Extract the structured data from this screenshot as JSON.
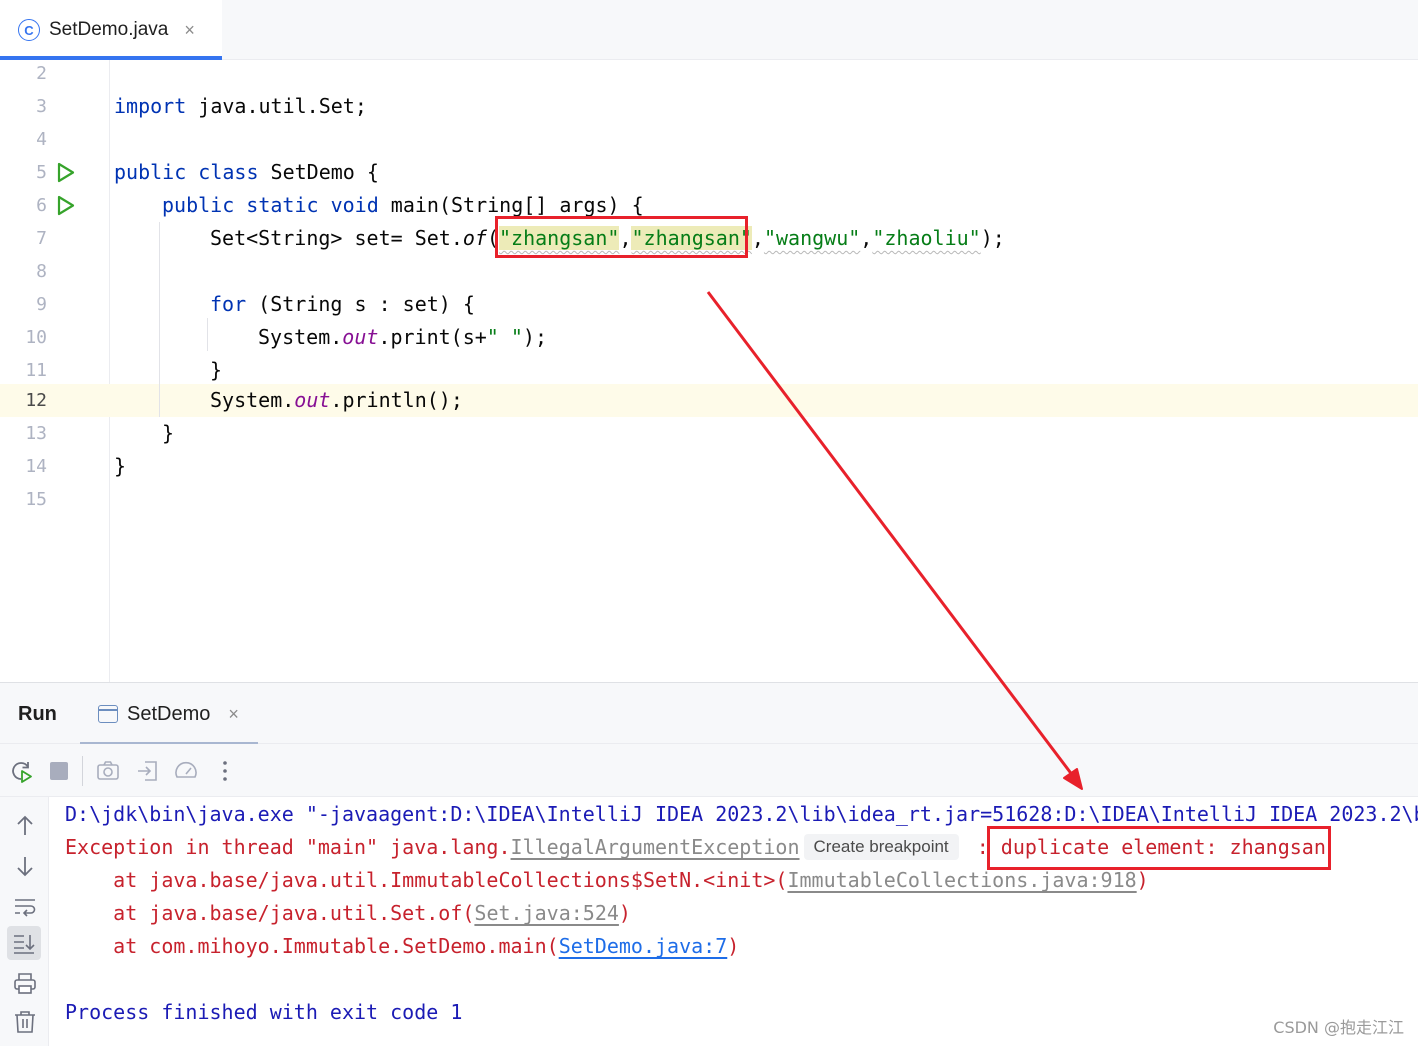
{
  "editor_tab": {
    "title": "SetDemo.java",
    "icon_letter": "C",
    "close_glyph": "×"
  },
  "code": {
    "line_numbers": [
      "2",
      "3",
      "4",
      "5",
      "6",
      "7",
      "8",
      "9",
      "10",
      "11",
      "12",
      "13",
      "14",
      "15"
    ],
    "import_kw": "import",
    "import_rest": " java.util.Set;",
    "class_kw": "public class",
    "class_rest": " SetDemo {",
    "main_kw": "public static void",
    "main_rest": " main(String[] args) {",
    "set_decl": "Set<String> set= Set.",
    "set_of": "of",
    "paren_open": "(",
    "str1": "\"zhangsan\"",
    "comma": ",",
    "str2": "\"zhangsan\"",
    "str3": "\"wangwu\"",
    "str4": "\"zhaoliu\"",
    "paren_close": ");",
    "for_kw": "for",
    "for_rest": " (String s : set) {",
    "print_pre": "System.",
    "out": "out",
    "print_post": ".print(s+",
    "print_str": "\" \"",
    "print_end": ");",
    "brace_close": "}",
    "println_post": ".println();"
  },
  "run_panel": {
    "title": "Run",
    "tab_label": "SetDemo",
    "tab_close": "×",
    "toolbar_icons": [
      "rerun-icon",
      "stop-icon",
      "camera-icon",
      "exit-icon",
      "gauge-icon",
      "more-icon"
    ],
    "side_icons": [
      "arrow-up-icon",
      "arrow-down-icon",
      "soft-wrap-icon",
      "scroll-to-end-icon",
      "print-icon",
      "trash-icon"
    ]
  },
  "console": {
    "cmd_line": "D:\\jdk\\bin\\java.exe \"-javaagent:D:\\IDEA\\IntelliJ IDEA 2023.2\\lib\\idea_rt.jar=51628:D:\\IDEA\\IntelliJ IDEA 2023.2\\b",
    "exc_prefix": "Exception in thread \"main\" java.lang.",
    "exc_class": "IllegalArgumentException",
    "breakpoint_chip": "Create breakpoint",
    "exc_sep": " : ",
    "exc_message": "duplicate element: zhangsan",
    "trace1_pre": "    at java.base/java.util.ImmutableCollections$SetN.<init>(",
    "trace1_link": "ImmutableCollections.java:918",
    "trace2_pre": "    at java.base/java.util.Set.of(",
    "trace2_link": "Set.java:524",
    "trace3_pre": "    at com.mihoyo.Immutable.SetDemo.main(",
    "trace3_link": "SetDemo.java:7",
    "trace_close": ")",
    "exit_line": "Process finished with exit code 1"
  },
  "watermark": "CSDN @抱走江江",
  "colors": {
    "accent": "#3574f0",
    "annotation": "#e8212b",
    "keyword": "#0033b3",
    "string": "#067d17",
    "error": "#c7222d"
  }
}
